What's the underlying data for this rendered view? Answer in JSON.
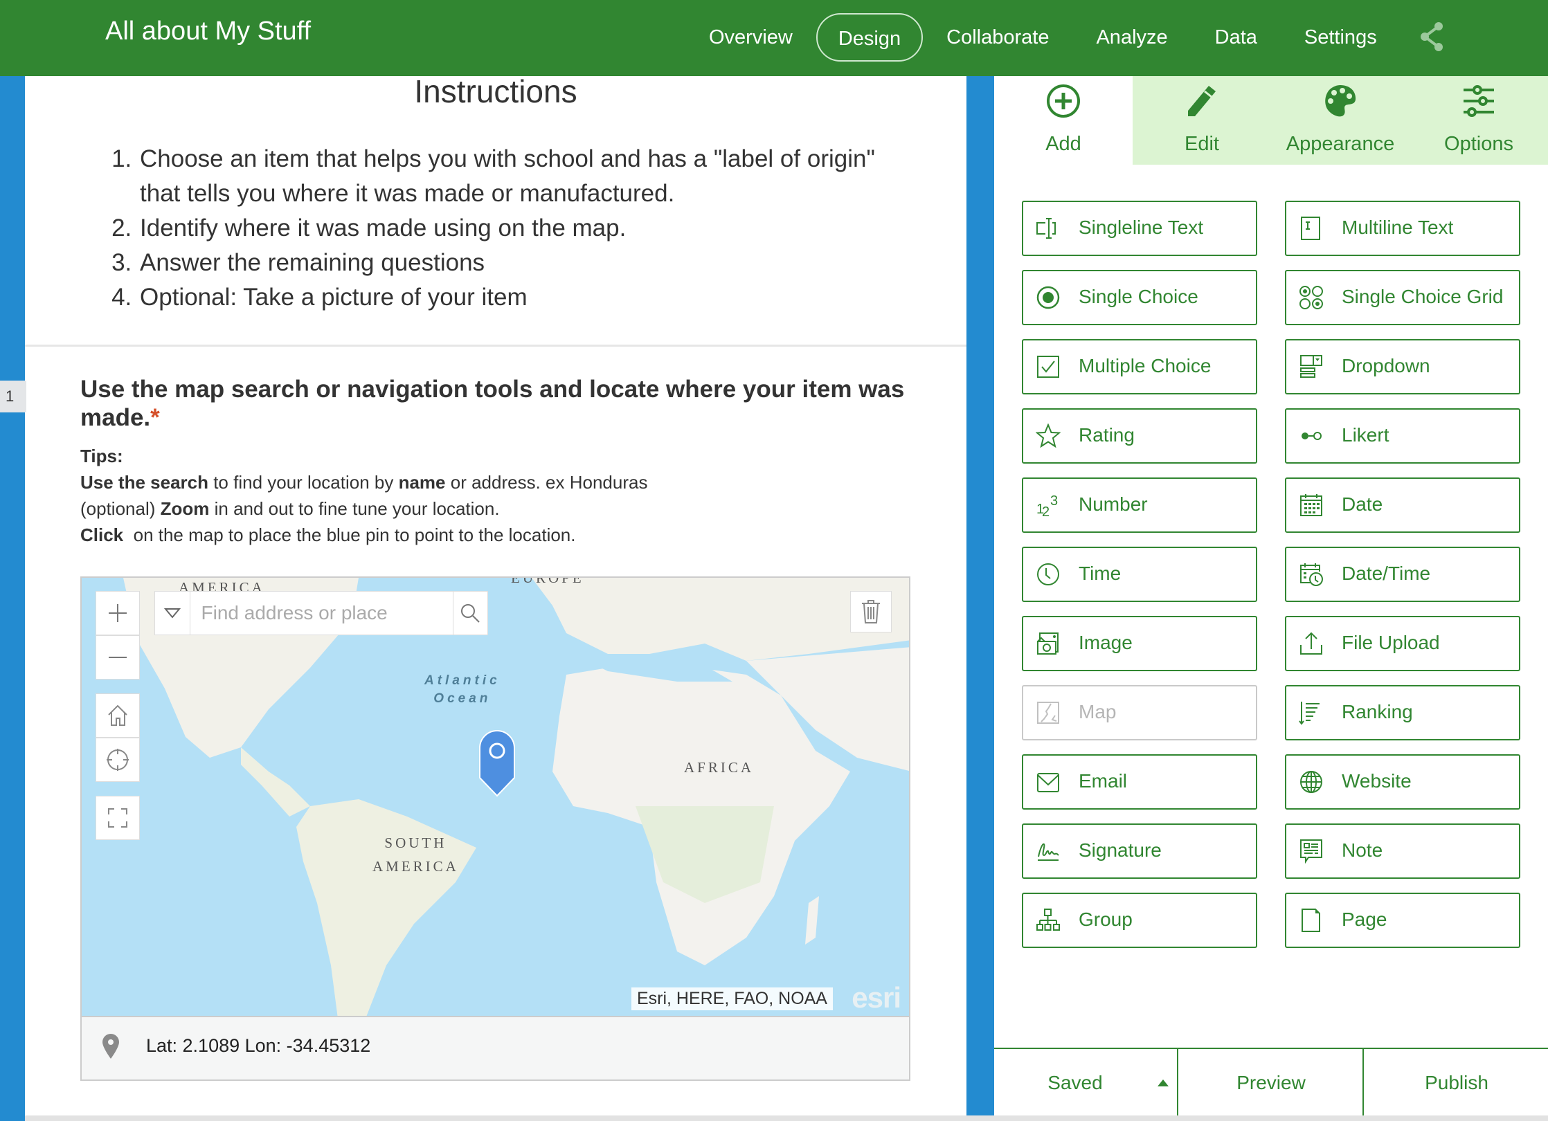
{
  "header": {
    "app_title": "All about My Stuff",
    "nav": [
      {
        "label": "Overview",
        "active": false
      },
      {
        "label": "Design",
        "active": true
      },
      {
        "label": "Collaborate",
        "active": false
      },
      {
        "label": "Analyze",
        "active": false
      },
      {
        "label": "Data",
        "active": false
      },
      {
        "label": "Settings",
        "active": false
      }
    ],
    "share_icon": "share-icon"
  },
  "colors": {
    "brand_green": "#318631",
    "tab_highlight": "#dcf4d2",
    "side_blue": "#238bd0",
    "required_red": "#d5502a",
    "pin_blue": "#4e8fe0"
  },
  "instructions": {
    "title": "Instructions",
    "items": [
      "Choose an item that helps you with school and has a \"label of origin\" that tells you where it was made or manufactured.",
      "Identify where it was made using on the map.",
      "Answer the remaining questions",
      "Optional: Take a picture of your item"
    ]
  },
  "question": {
    "number": "1",
    "title": "Use the map search or navigation tools and locate where your item was made.",
    "required_mark": "*",
    "tips_label": "Tips:",
    "tips": [
      {
        "bold": "Use the search",
        "text1": " to find your location by ",
        "bold2": "name",
        "text2": " or address. ex Honduras"
      },
      {
        "prefix": "(optional) ",
        "bold": "Zoom",
        "text1": " in and out to fine tune your location."
      },
      {
        "bold": "Click",
        "text1": "  on the map to place the blue pin to point to the location."
      }
    ]
  },
  "map": {
    "search_placeholder": "Find address or place",
    "search_value": "",
    "labels": {
      "north_america": "AMERICA",
      "europe": "EUROPE",
      "atlantic": "Atlantic\nOcean",
      "atlantic_1": "Atlantic",
      "atlantic_2": "Ocean",
      "africa": "AFRICA",
      "south_america_1": "SOUTH",
      "south_america_2": "AMERICA"
    },
    "attribution": "Esri, HERE, FAO, NOAA",
    "logo": "esri",
    "controls": [
      "zoom-in",
      "zoom-out",
      "home",
      "locate",
      "fullscreen",
      "delete"
    ],
    "coordinates": "Lat: 2.1089 Lon: -34.45312"
  },
  "panel": {
    "tabs": [
      {
        "label": "Add",
        "icon": "plus-circle-icon",
        "active": true
      },
      {
        "label": "Edit",
        "icon": "pencil-icon",
        "active": false
      },
      {
        "label": "Appearance",
        "icon": "palette-icon",
        "active": false
      },
      {
        "label": "Options",
        "icon": "sliders-icon",
        "active": false
      }
    ],
    "fields": [
      {
        "label": "Singleline Text",
        "icon": "singleline-text-icon",
        "enabled": true
      },
      {
        "label": "Multiline Text",
        "icon": "multiline-text-icon",
        "enabled": true
      },
      {
        "label": "Single Choice",
        "icon": "radio-icon",
        "enabled": true
      },
      {
        "label": "Single Choice Grid",
        "icon": "radio-grid-icon",
        "enabled": true
      },
      {
        "label": "Multiple Choice",
        "icon": "checkbox-icon",
        "enabled": true
      },
      {
        "label": "Dropdown",
        "icon": "dropdown-icon",
        "enabled": true
      },
      {
        "label": "Rating",
        "icon": "star-icon",
        "enabled": true
      },
      {
        "label": "Likert",
        "icon": "likert-icon",
        "enabled": true
      },
      {
        "label": "Number",
        "icon": "number-icon",
        "enabled": true
      },
      {
        "label": "Date",
        "icon": "calendar-icon",
        "enabled": true
      },
      {
        "label": "Time",
        "icon": "clock-icon",
        "enabled": true
      },
      {
        "label": "Date/Time",
        "icon": "calendar-clock-icon",
        "enabled": true
      },
      {
        "label": "Image",
        "icon": "camera-icon",
        "enabled": true
      },
      {
        "label": "File Upload",
        "icon": "upload-icon",
        "enabled": true
      },
      {
        "label": "Map",
        "icon": "map-icon",
        "enabled": false
      },
      {
        "label": "Ranking",
        "icon": "ranking-icon",
        "enabled": true
      },
      {
        "label": "Email",
        "icon": "envelope-icon",
        "enabled": true
      },
      {
        "label": "Website",
        "icon": "globe-icon",
        "enabled": true
      },
      {
        "label": "Signature",
        "icon": "signature-icon",
        "enabled": true
      },
      {
        "label": "Note",
        "icon": "note-icon",
        "enabled": true
      },
      {
        "label": "Group",
        "icon": "group-icon",
        "enabled": true
      },
      {
        "label": "Page",
        "icon": "page-icon",
        "enabled": true
      }
    ],
    "footer": {
      "saved": "Saved",
      "preview": "Preview",
      "publish": "Publish"
    }
  }
}
